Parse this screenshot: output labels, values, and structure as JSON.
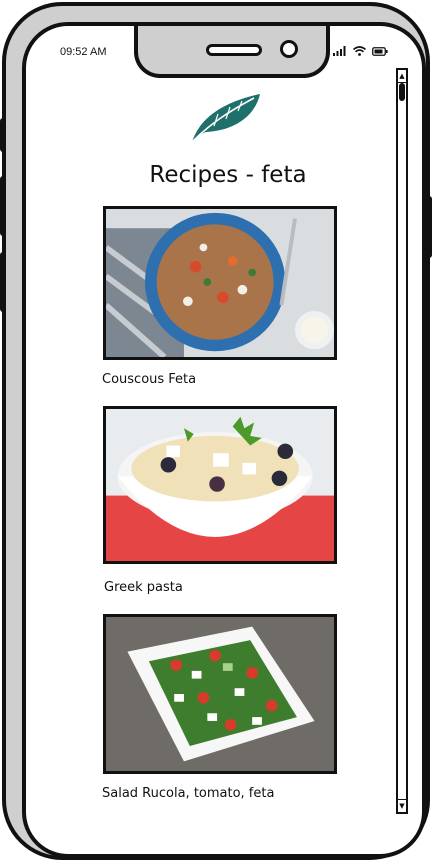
{
  "status_bar": {
    "time": "09:52 AM"
  },
  "page": {
    "title": "Recipes - feta"
  },
  "recipes": [
    {
      "label": "Couscous Feta",
      "icon": "couscous-salad-photo"
    },
    {
      "label": "Greek pasta",
      "icon": "greek-pasta-photo"
    },
    {
      "label": "Salad Rucola, tomato, feta",
      "icon": "rucola-salad-photo"
    }
  ],
  "colors": {
    "logo_leaf": "#1f6f6b",
    "frame": "#111111",
    "bezel": "#cfcfcf"
  }
}
